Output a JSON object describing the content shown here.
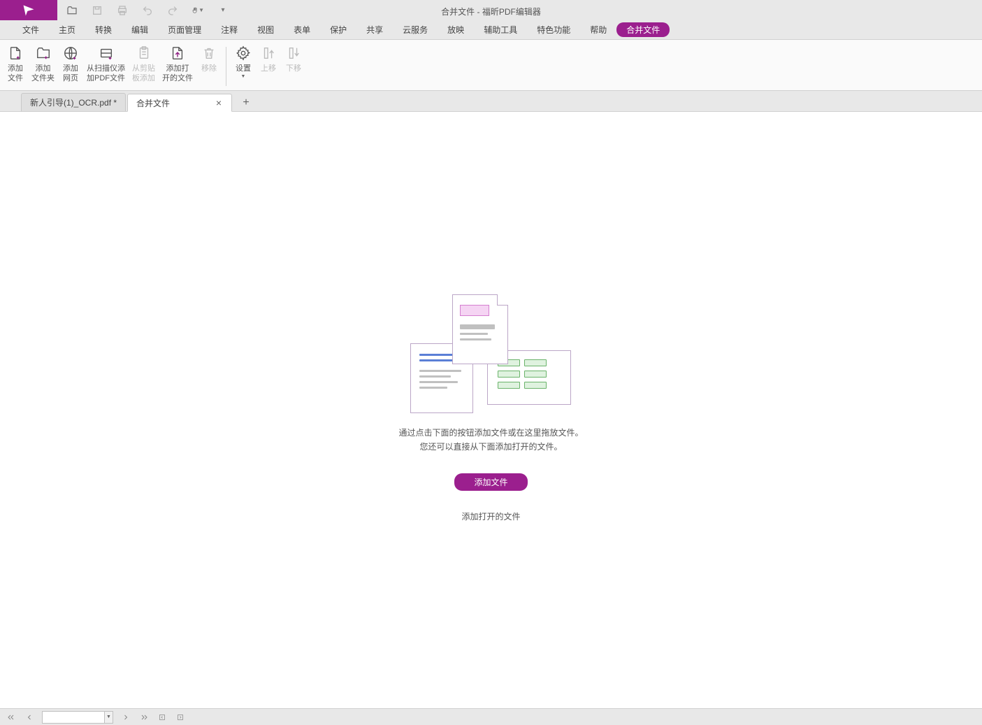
{
  "app": {
    "title": "合并文件 - 福昕PDF编辑器"
  },
  "menu": {
    "file": "文件",
    "home": "主页",
    "convert": "转换",
    "edit": "编辑",
    "page": "页面管理",
    "annotate": "注释",
    "view": "视图",
    "form": "表单",
    "protect": "保护",
    "share": "共享",
    "cloud": "云服务",
    "play": "放映",
    "aux": "辅助工具",
    "special": "特色功能",
    "help": "帮助",
    "merge": "合并文件"
  },
  "ribbon": {
    "add_file": "添加\n文件",
    "add_folder": "添加\n文件夹",
    "add_web": "添加\n网页",
    "from_scanner": "从扫描仪添\n加PDF文件",
    "from_clipboard": "从剪贴\n板添加",
    "add_open": "添加打\n开的文件",
    "remove": "移除",
    "settings": "设置",
    "move_up": "上移",
    "move_down": "下移"
  },
  "tabs": {
    "t1": "新人引导(1)_OCR.pdf *",
    "t2": "合并文件"
  },
  "empty": {
    "line1": "通过点击下面的按钮添加文件或在这里拖放文件。",
    "line2": "您还可以直接从下面添加打开的文件。",
    "add_btn": "添加文件",
    "add_open_btn": "添加打开的文件"
  },
  "status": {
    "page_value": ""
  }
}
